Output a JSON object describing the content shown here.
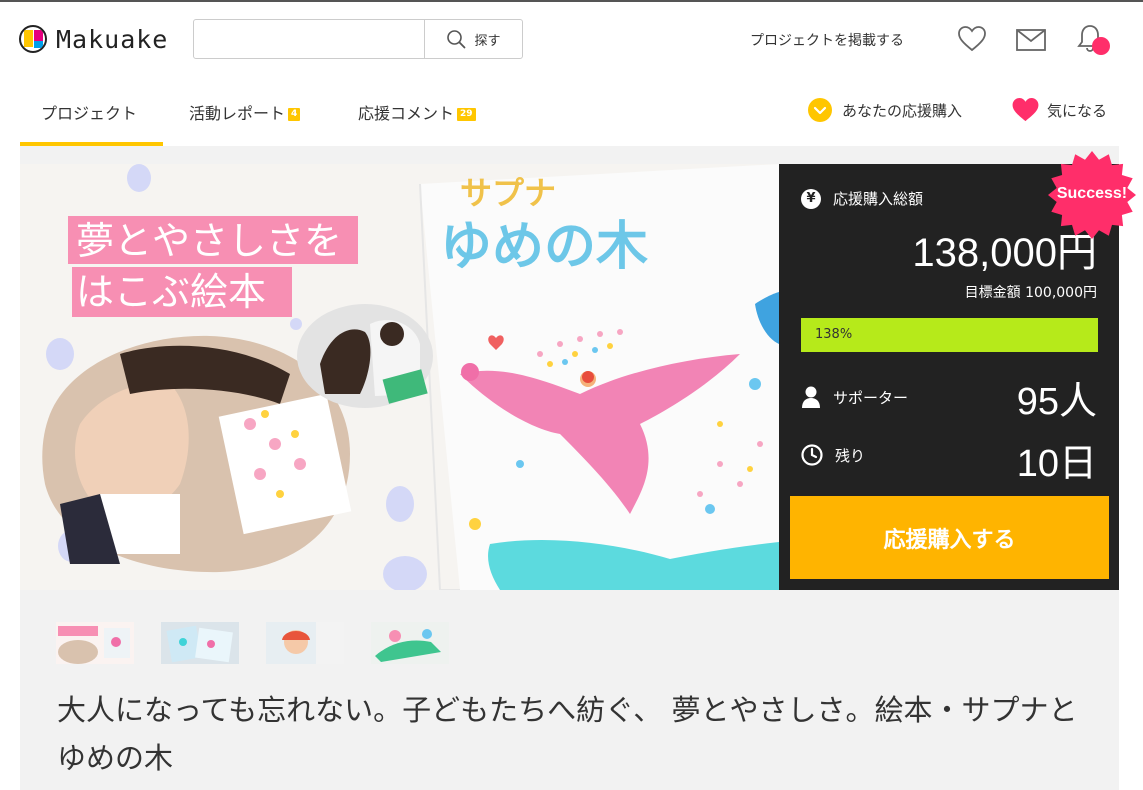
{
  "header": {
    "logo_text": "Makuake",
    "search": {
      "value": "",
      "placeholder": "",
      "button_label": "探す"
    },
    "post_project_label": "プロジェクトを掲載する",
    "icons": [
      "heart-icon",
      "mail-icon",
      "bell-icon"
    ]
  },
  "tabs": [
    {
      "label": "プロジェクト",
      "badge": ""
    },
    {
      "label": "活動レポート",
      "badge": "4"
    },
    {
      "label": "応援コメント",
      "badge": "29"
    }
  ],
  "actions": {
    "supported_label": "あなたの応援購入",
    "favorite_label": "気になる"
  },
  "hero": {
    "catch_line1": "夢とやさしさを",
    "catch_line2": "はこぶ絵本",
    "book_title_top": "サプナ",
    "book_title_main": "ゆめの木"
  },
  "panel": {
    "total_label": "応援購入総額",
    "total_value": "138,000円",
    "goal_text": "目標金額 100,000円",
    "progress_percent": 138,
    "progress_label": "138%",
    "supporters_label": "サポーター",
    "supporters_value": "95人",
    "remaining_label": "残り",
    "remaining_value": "10日",
    "cta_label": "応援購入する",
    "success_badge": "Success!"
  },
  "project_title": "大人になっても忘れない。子どもたちへ紡ぐ、 夢とやさしさ。絵本・サプナとゆめの木",
  "colors": {
    "accent_yellow": "#ffc600",
    "cta_orange": "#ffb400",
    "progress_green": "#b6ea1a",
    "pink": "#ff2e6a",
    "panel_bg": "#222222"
  }
}
